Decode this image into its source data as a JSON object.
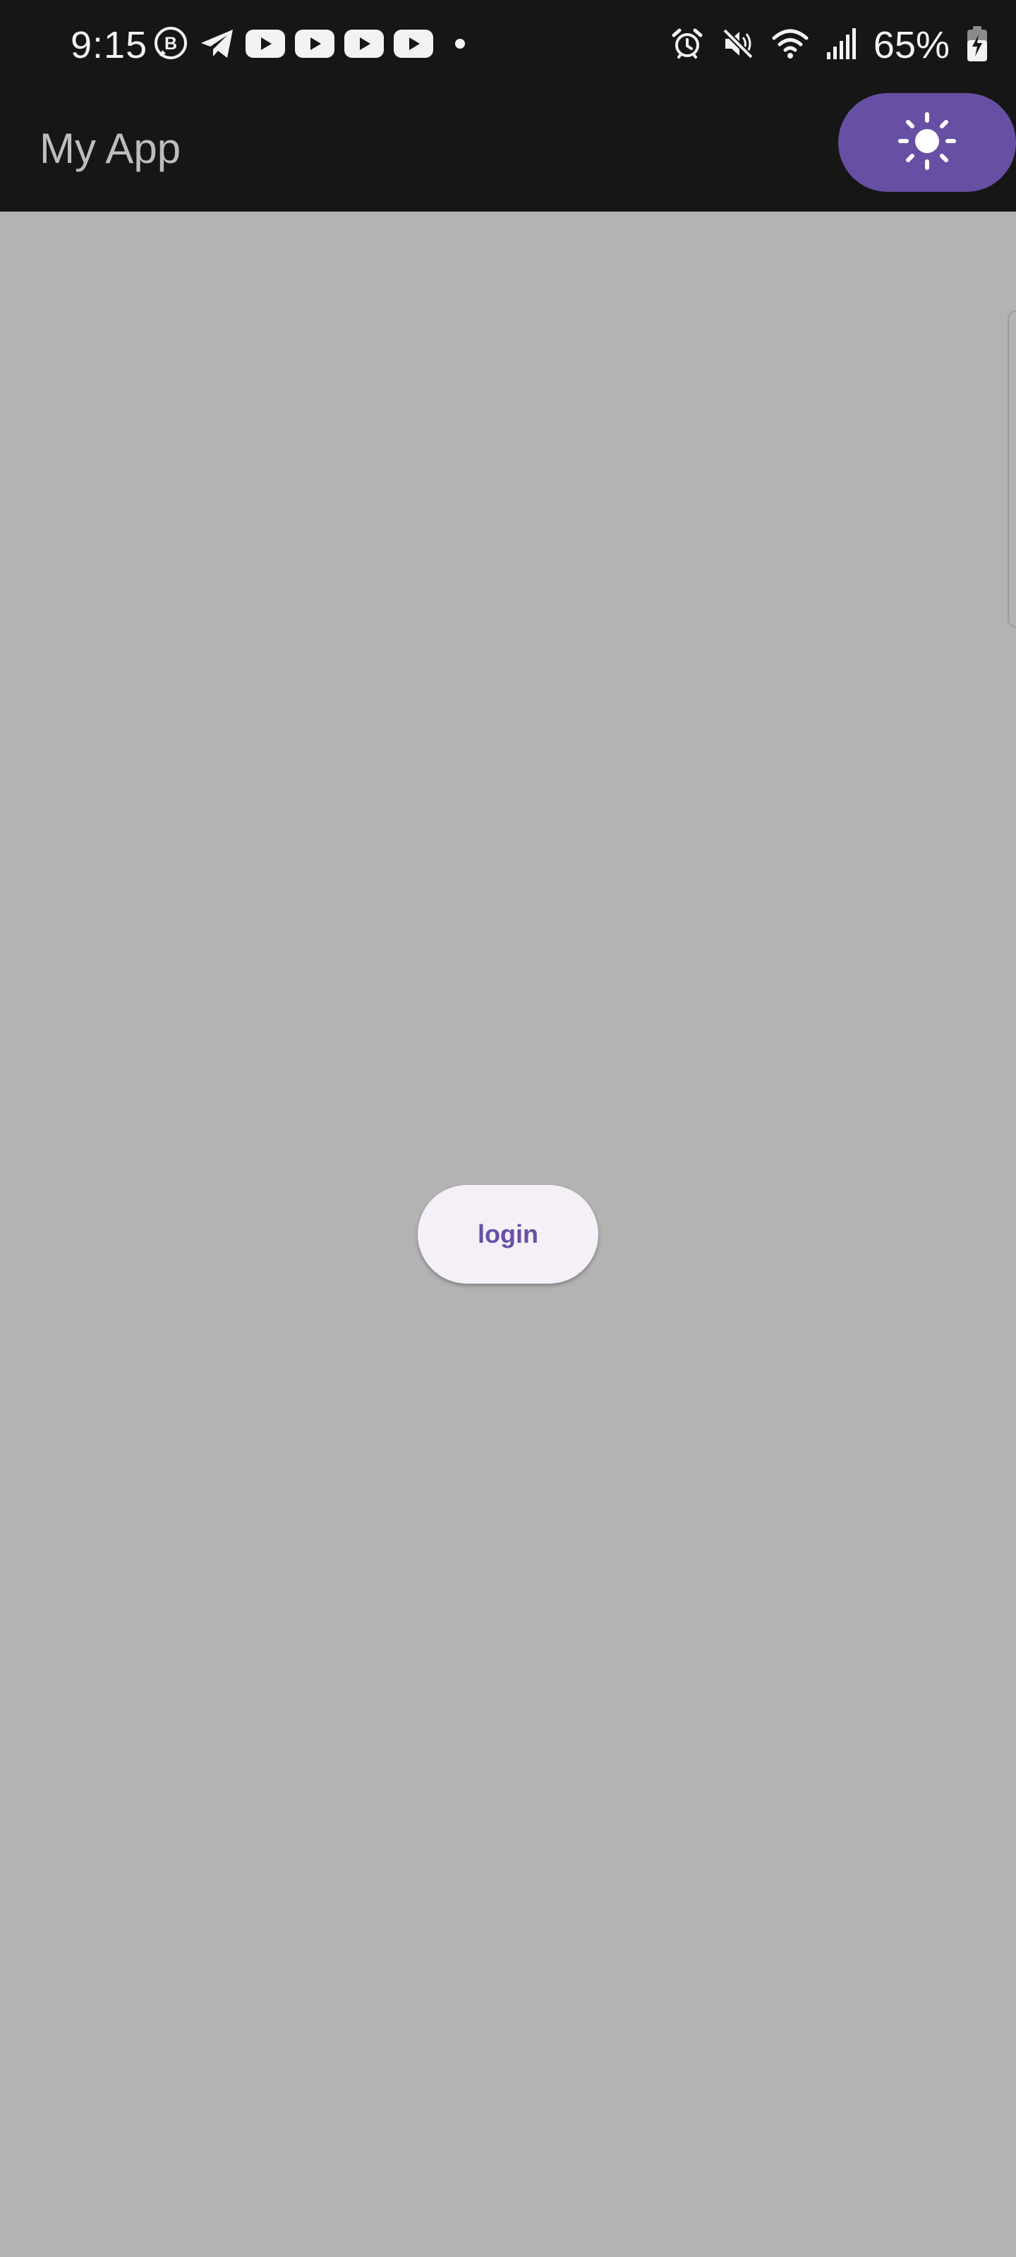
{
  "status_bar": {
    "time": "9:15",
    "left_icons": [
      "whatsapp-business-icon",
      "telegram-icon",
      "youtube-icon",
      "youtube-icon",
      "youtube-icon",
      "youtube-icon",
      "dot-icon"
    ],
    "right_icons": [
      "alarm-icon",
      "mute-icon",
      "wifi-icon",
      "signal-icon",
      "battery-charging-icon"
    ],
    "battery": "65%"
  },
  "app_bar": {
    "title": "My App",
    "theme_icon": "sun-icon",
    "accent": "#6750a4"
  },
  "main": {
    "login_label": "login",
    "background": "#b3b3b3"
  }
}
